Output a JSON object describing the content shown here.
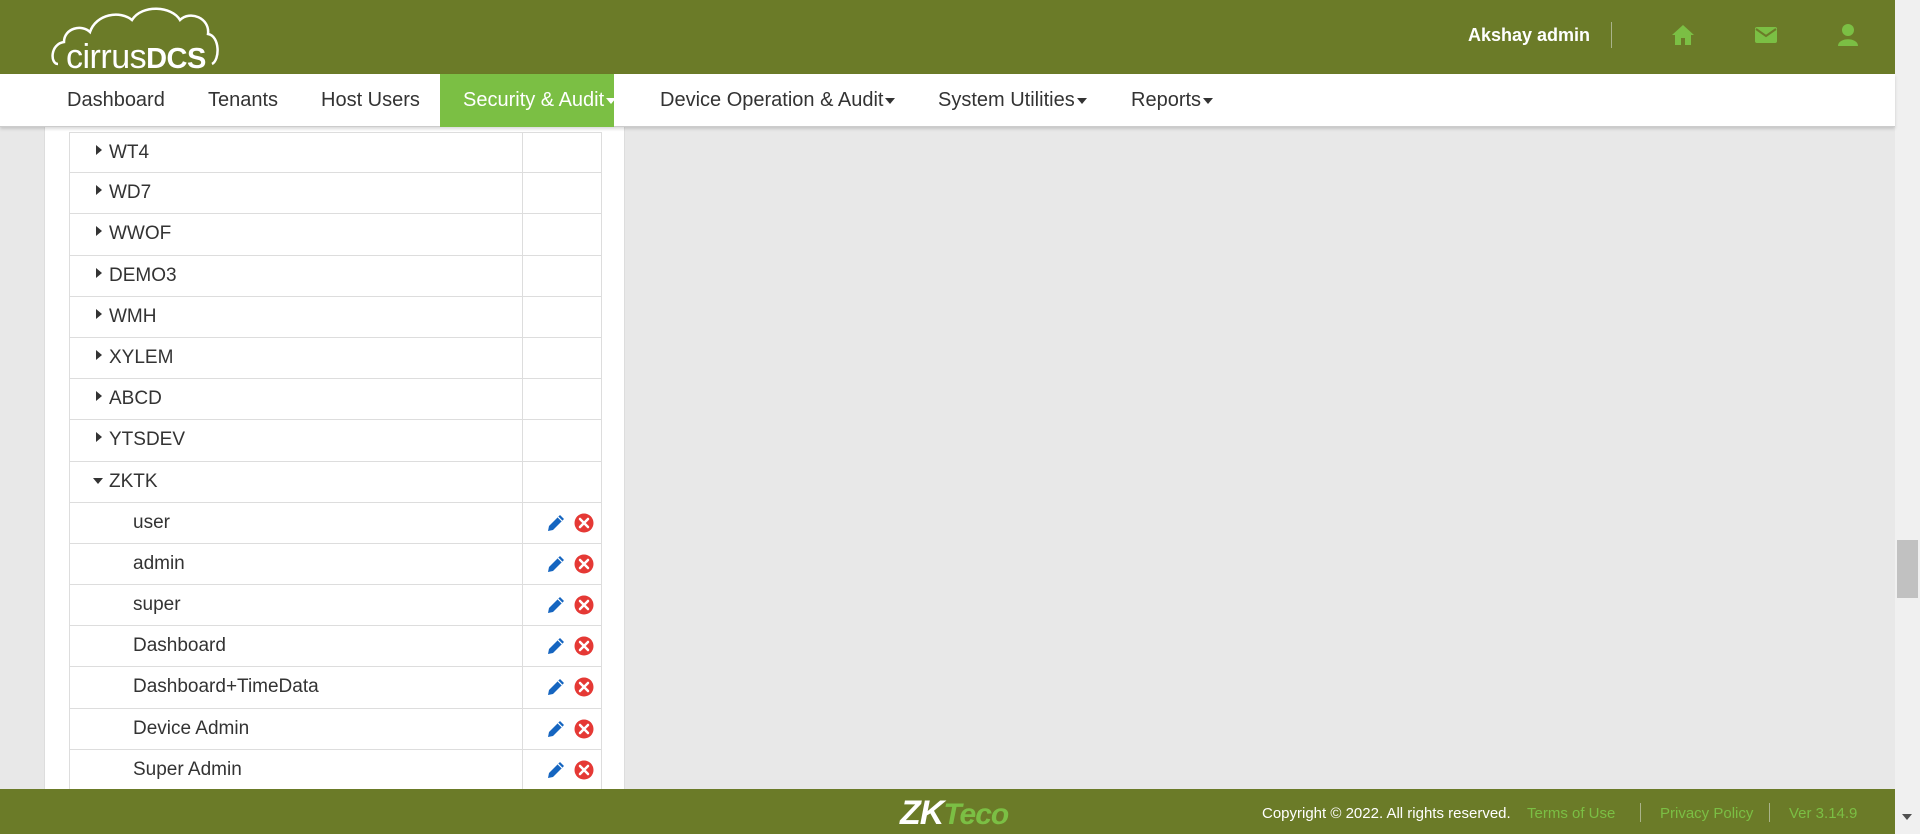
{
  "header": {
    "logo_text_light": "cirrus",
    "logo_text_bold": "DCS",
    "user_name": "Akshay admin",
    "icons": [
      "home-icon",
      "envelope-icon",
      "user-icon"
    ]
  },
  "nav": {
    "items": [
      {
        "label": "Dashboard"
      },
      {
        "label": "Tenants"
      },
      {
        "label": "Host Users"
      },
      {
        "label": "Security & Audit",
        "active": true,
        "dropdown": true
      },
      {
        "label": "Device Operation & Audit",
        "dropdown": true
      },
      {
        "label": "System Utilities",
        "dropdown": true
      },
      {
        "label": "Reports",
        "dropdown": true
      }
    ]
  },
  "tree": {
    "collapsed": [
      "WT4",
      "WD7",
      "WWOF",
      "DEMO3",
      "WMH",
      "XYLEM",
      "ABCD",
      "YTSDEV"
    ],
    "expanded": {
      "label": "ZKTK",
      "children": [
        "user",
        "admin",
        "super",
        "Dashboard",
        "Dashboard+TimeData",
        "Device Admin",
        "Super Admin"
      ]
    }
  },
  "footer": {
    "brand_zk": "ZK",
    "brand_teco": "Teco",
    "copyright": "Copyright © 2022. All rights reserved.",
    "terms": "Terms of Use",
    "privacy": "Privacy Policy",
    "version": "Ver 3.14.9"
  },
  "colors": {
    "header_bg": "#6b7b28",
    "accent_green": "#7bbf44",
    "edit_blue": "#1565c0",
    "delete_red": "#e53935"
  }
}
